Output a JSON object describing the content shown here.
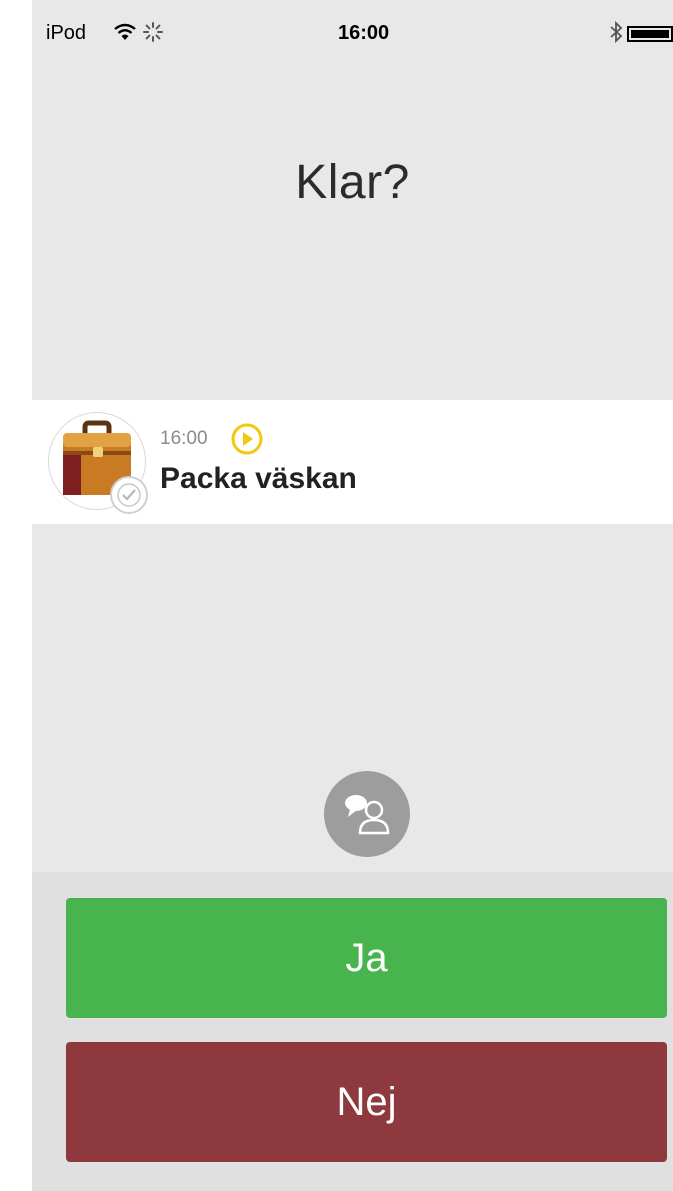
{
  "status_bar": {
    "carrier": "iPod",
    "time": "16:00",
    "icons": [
      "wifi-icon",
      "activity-spinner-icon",
      "bluetooth-icon",
      "battery-icon"
    ]
  },
  "screen": {
    "title": "Klar?"
  },
  "activity": {
    "time": "16:00",
    "name": "Packa väskan",
    "icon": "briefcase-icon",
    "completed_badge": "check-icon",
    "alarm_icon": "alarm-icon"
  },
  "support_icon": "speech-person-icon",
  "buttons": {
    "yes_label": "Ja",
    "no_label": "Nej"
  },
  "colors": {
    "background": "#e8e8e8",
    "yes": "#48b44d",
    "no": "#8e393d",
    "alarm": "#f2c811"
  }
}
